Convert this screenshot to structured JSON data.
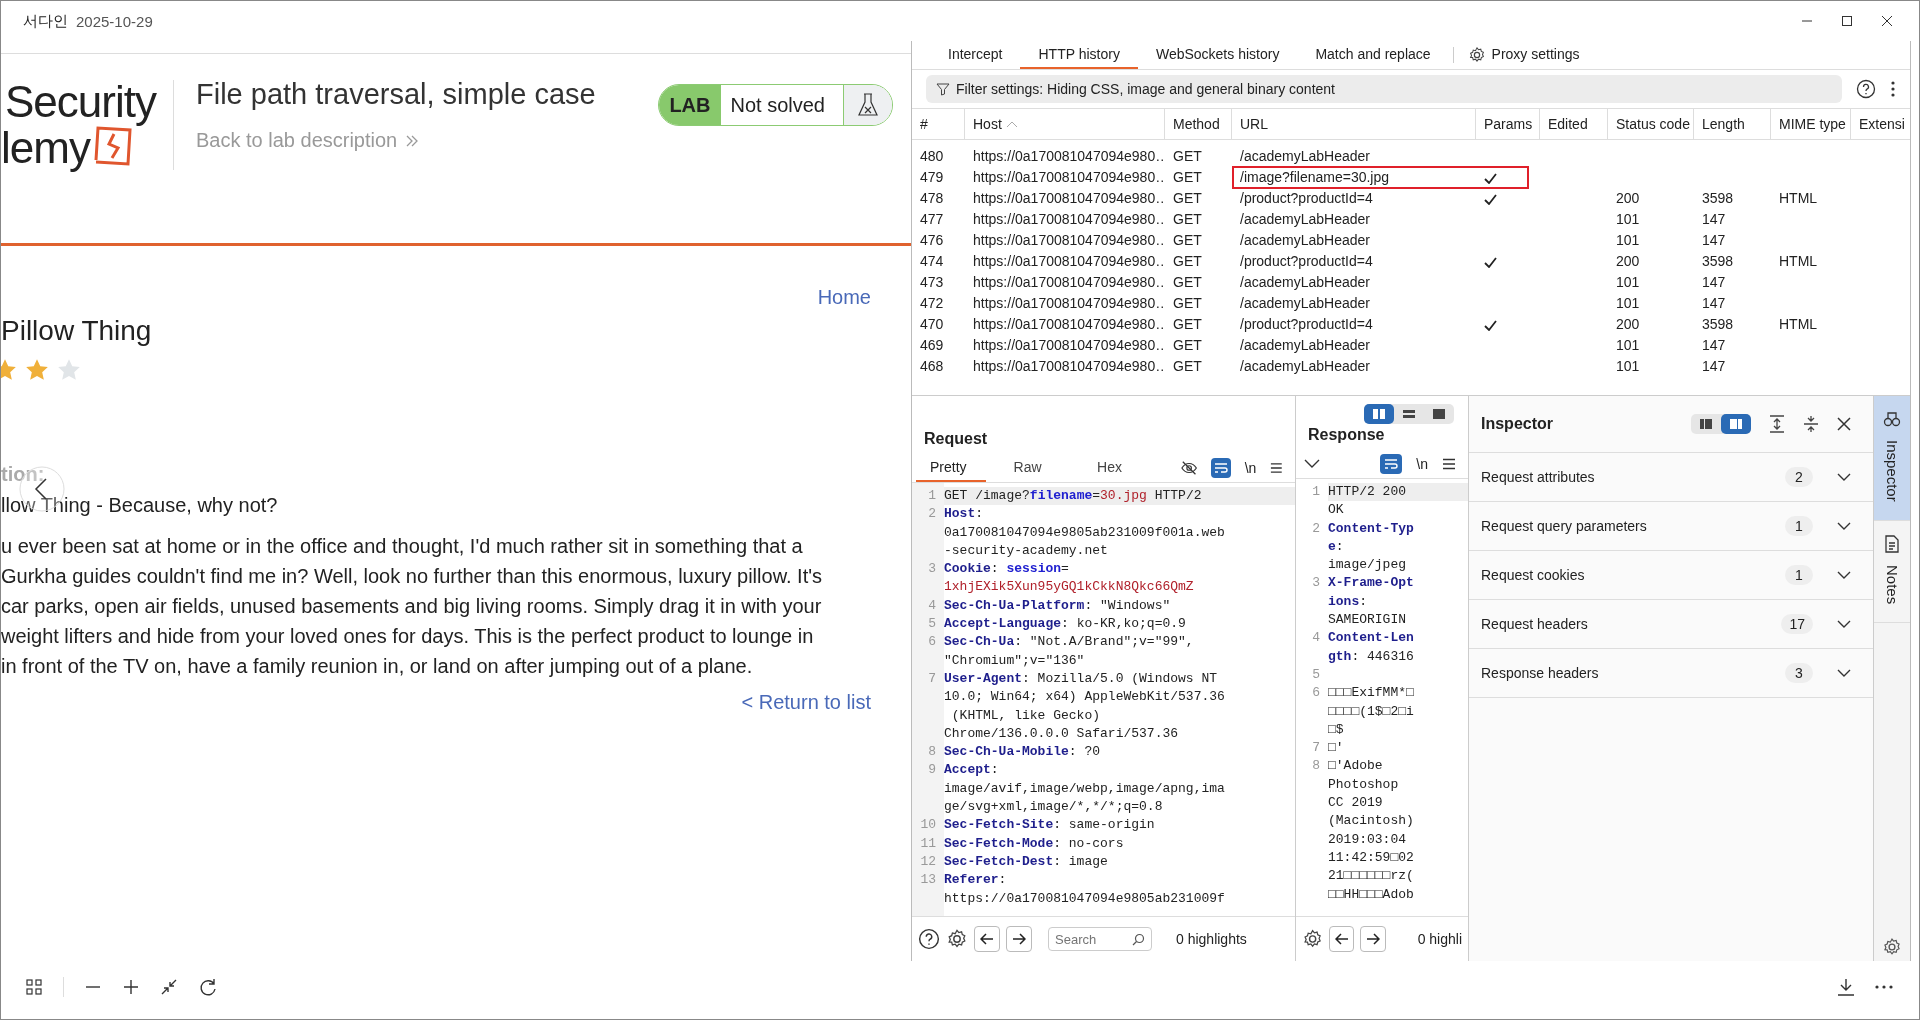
{
  "window": {
    "title": "서다인",
    "date": "2025-10-29"
  },
  "lab_page": {
    "logo_lines": [
      "Security",
      "lemy"
    ],
    "title": "File path traversal, simple case",
    "back_link": "Back to lab description",
    "status_label": "LAB",
    "status": "Not solved",
    "home_link": "Home",
    "product_name": "Pillow Thing",
    "stars": 2,
    "section_label": "tion:",
    "tagline": "llow Thing - Because, why not?",
    "description_lines": [
      "u ever been sat at home or in the office and thought, I'd much rather sit in something that a",
      "Gurkha guides couldn't find me in? Well, look no further than this enormous, luxury pillow. It's",
      "car parks, open air fields, unused basements and big living rooms. Simply drag it in with your",
      "weight lifters and hide from your loved ones for days. This is the perfect product to lounge in",
      "in front of the TV on, have a family reunion in, or land on after jumping out of a plane."
    ],
    "return_link": "< Return to list"
  },
  "burp": {
    "tabs": [
      {
        "label": "Intercept",
        "selected": false
      },
      {
        "label": "HTTP history",
        "selected": true
      },
      {
        "label": "WebSockets history",
        "selected": false
      },
      {
        "label": "Match and replace",
        "selected": false
      }
    ],
    "settings_tab": "Proxy settings",
    "filter": "Filter settings: Hiding CSS, image and general binary content",
    "table": {
      "columns": [
        "#",
        "Host",
        "Method",
        "URL",
        "Params",
        "Edited",
        "Status code",
        "Length",
        "MIME type",
        "Extensi"
      ],
      "rows": [
        {
          "num": "480",
          "host": "https://0a170081047094e980…",
          "method": "GET",
          "url": "/academyLabHeader",
          "params": false,
          "highlighted": false
        },
        {
          "num": "479",
          "host": "https://0a170081047094e980…",
          "method": "GET",
          "url": "/image?filename=30.jpg",
          "params": true,
          "highlighted": true
        },
        {
          "num": "478",
          "host": "https://0a170081047094e980…",
          "method": "GET",
          "url": "/product?productId=4",
          "params": true,
          "highlighted": false,
          "status": "200",
          "length": "3598",
          "mime": "HTML"
        },
        {
          "num": "477",
          "host": "https://0a170081047094e980…",
          "method": "GET",
          "url": "/academyLabHeader",
          "params": false,
          "highlighted": false,
          "status": "101",
          "length": "147"
        },
        {
          "num": "476",
          "host": "https://0a170081047094e980…",
          "method": "GET",
          "url": "/academyLabHeader",
          "params": false,
          "highlighted": false,
          "status": "101",
          "length": "147"
        },
        {
          "num": "474",
          "host": "https://0a170081047094e980…",
          "method": "GET",
          "url": "/product?productId=4",
          "params": true,
          "highlighted": false,
          "status": "200",
          "length": "3598",
          "mime": "HTML"
        },
        {
          "num": "473",
          "host": "https://0a170081047094e980…",
          "method": "GET",
          "url": "/academyLabHeader",
          "params": false,
          "highlighted": false,
          "status": "101",
          "length": "147"
        },
        {
          "num": "472",
          "host": "https://0a170081047094e980…",
          "method": "GET",
          "url": "/academyLabHeader",
          "params": false,
          "highlighted": false,
          "status": "101",
          "length": "147"
        },
        {
          "num": "470",
          "host": "https://0a170081047094e980…",
          "method": "GET",
          "url": "/product?productId=4",
          "params": true,
          "highlighted": false,
          "status": "200",
          "length": "3598",
          "mime": "HTML"
        },
        {
          "num": "469",
          "host": "https://0a170081047094e980…",
          "method": "GET",
          "url": "/academyLabHeader",
          "params": false,
          "highlighted": false,
          "status": "101",
          "length": "147"
        },
        {
          "num": "468",
          "host": "https://0a170081047094e980…",
          "method": "GET",
          "url": "/academyLabHeader",
          "params": false,
          "highlighted": false,
          "status": "101",
          "length": "147"
        }
      ]
    },
    "request": {
      "title": "Request",
      "tabs": [
        {
          "label": "Pretty",
          "selected": true
        },
        {
          "label": "Raw",
          "selected": false
        },
        {
          "label": "Hex",
          "selected": false
        }
      ],
      "wrap_on": true,
      "newline_toggle": "\\n",
      "lines": [
        {
          "num": "1",
          "rows": [
            [
              {
                "kind": "plain",
                "text": "GET /image?"
              },
              {
                "kind": "param",
                "text": "filename"
              },
              {
                "kind": "plain",
                "text": "="
              },
              {
                "kind": "value",
                "text": "30.jpg"
              },
              {
                "kind": "plain",
                "text": " HTTP/2"
              }
            ]
          ]
        },
        {
          "num": "2",
          "rows": [
            [
              {
                "kind": "key",
                "text": "Host"
              },
              {
                "kind": "plain",
                "text": ":"
              }
            ],
            [
              {
                "kind": "plain",
                "text": "0a170081047094e9805ab231009f001a.web"
              }
            ],
            [
              {
                "kind": "plain",
                "text": "-security-academy.net"
              }
            ]
          ]
        },
        {
          "num": "3",
          "rows": [
            [
              {
                "kind": "key",
                "text": "Cookie"
              },
              {
                "kind": "plain",
                "text": ": "
              },
              {
                "kind": "param",
                "text": "session"
              },
              {
                "kind": "plain",
                "text": "="
              }
            ],
            [
              {
                "kind": "value",
                "text": "1xhjEXik5Xun95yGQ1kCkkN8Qkc66QmZ"
              }
            ]
          ]
        },
        {
          "num": "4",
          "rows": [
            [
              {
                "kind": "key",
                "text": "Sec-Ch-Ua-Platform"
              },
              {
                "kind": "plain",
                "text": ": \"Windows\""
              }
            ]
          ]
        },
        {
          "num": "5",
          "rows": [
            [
              {
                "kind": "key",
                "text": "Accept-Language"
              },
              {
                "kind": "plain",
                "text": ": ko-KR,ko;q=0.9"
              }
            ]
          ]
        },
        {
          "num": "6",
          "rows": [
            [
              {
                "kind": "key",
                "text": "Sec-Ch-Ua"
              },
              {
                "kind": "plain",
                "text": ": \"Not.A/Brand\";v=\"99\","
              }
            ],
            [
              {
                "kind": "plain",
                "text": "\"Chromium\";v=\"136\""
              }
            ]
          ]
        },
        {
          "num": "7",
          "rows": [
            [
              {
                "kind": "key",
                "text": "User-Agent"
              },
              {
                "kind": "plain",
                "text": ": Mozilla/5.0 (Windows NT"
              }
            ],
            [
              {
                "kind": "plain",
                "text": "10.0; Win64; x64) AppleWebKit/537.36"
              }
            ],
            [
              {
                "kind": "plain",
                "text": " (KHTML, like Gecko)"
              }
            ],
            [
              {
                "kind": "plain",
                "text": "Chrome/136.0.0.0 Safari/537.36"
              }
            ]
          ]
        },
        {
          "num": "8",
          "rows": [
            [
              {
                "kind": "key",
                "text": "Sec-Ch-Ua-Mobile"
              },
              {
                "kind": "plain",
                "text": ": ?0"
              }
            ]
          ]
        },
        {
          "num": "9",
          "rows": [
            [
              {
                "kind": "key",
                "text": "Accept"
              },
              {
                "kind": "plain",
                "text": ":"
              }
            ],
            [
              {
                "kind": "plain",
                "text": "image/avif,image/webp,image/apng,ima"
              }
            ],
            [
              {
                "kind": "plain",
                "text": "ge/svg+xml,image/*,*/*;q=0.8"
              }
            ]
          ]
        },
        {
          "num": "10",
          "rows": [
            [
              {
                "kind": "key",
                "text": "Sec-Fetch-Site"
              },
              {
                "kind": "plain",
                "text": ": same-origin"
              }
            ]
          ]
        },
        {
          "num": "11",
          "rows": [
            [
              {
                "kind": "key",
                "text": "Sec-Fetch-Mode"
              },
              {
                "kind": "plain",
                "text": ": no-cors"
              }
            ]
          ]
        },
        {
          "num": "12",
          "rows": [
            [
              {
                "kind": "key",
                "text": "Sec-Fetch-Dest"
              },
              {
                "kind": "plain",
                "text": ": image"
              }
            ]
          ]
        },
        {
          "num": "13",
          "rows": [
            [
              {
                "kind": "key",
                "text": "Referer"
              },
              {
                "kind": "plain",
                "text": ":"
              }
            ],
            [
              {
                "kind": "plain",
                "text": "https://0a170081047094e9805ab231009f"
              }
            ]
          ]
        }
      ],
      "search_placeholder": "Search",
      "highlights": "0 highlights"
    },
    "response": {
      "title": "Response",
      "layout_buttons": [
        {
          "selected": true
        },
        {
          "selected": false
        },
        {
          "selected": false
        }
      ],
      "wrap_on": true,
      "newline_toggle": "\\n",
      "lines": [
        {
          "num": "1",
          "rows": [
            [
              {
                "kind": "plain",
                "text": "HTTP/2 200"
              }
            ],
            [
              {
                "kind": "plain",
                "text": "OK"
              }
            ]
          ]
        },
        {
          "num": "2",
          "rows": [
            [
              {
                "kind": "key",
                "text": "Content-Typ"
              }
            ],
            [
              {
                "kind": "key",
                "text": "e"
              },
              {
                "kind": "plain",
                "text": ":"
              }
            ],
            [
              {
                "kind": "plain",
                "text": "image/jpeg"
              }
            ]
          ]
        },
        {
          "num": "3",
          "rows": [
            [
              {
                "kind": "key",
                "text": "X-Frame-Opt"
              }
            ],
            [
              {
                "kind": "key",
                "text": "ions"
              },
              {
                "kind": "plain",
                "text": ":"
              }
            ],
            [
              {
                "kind": "plain",
                "text": "SAMEORIGIN"
              }
            ]
          ]
        },
        {
          "num": "4",
          "rows": [
            [
              {
                "kind": "key",
                "text": "Content-Len"
              }
            ],
            [
              {
                "kind": "key",
                "text": "gth"
              },
              {
                "kind": "plain",
                "text": ": 446316"
              }
            ]
          ]
        },
        {
          "num": "5"
        },
        {
          "num": "6",
          "rows": [
            [
              {
                "kind": "plain",
                "text": "□□□ExifMM*□"
              }
            ],
            [
              {
                "kind": "plain",
                "text": "□□□□(1$□2□i"
              }
            ],
            [
              {
                "kind": "plain",
                "text": "□$"
              }
            ]
          ]
        },
        {
          "num": "7",
          "rows": [
            [
              {
                "kind": "plain",
                "text": "□'"
              }
            ]
          ]
        },
        {
          "num": "8",
          "rows": [
            [
              {
                "kind": "plain",
                "text": "□'Adobe"
              }
            ],
            [
              {
                "kind": "plain",
                "text": "Photoshop"
              }
            ],
            [
              {
                "kind": "plain",
                "text": "CC 2019"
              }
            ],
            [
              {
                "kind": "plain",
                "text": "(Macintosh)"
              }
            ],
            [
              {
                "kind": "plain",
                "text": "2019:03:04"
              }
            ],
            [
              {
                "kind": "plain",
                "text": "11:42:59□02"
              }
            ],
            [
              {
                "kind": "plain",
                "text": "21□□□□□□rz("
              }
            ],
            [
              {
                "kind": "plain",
                "text": "□□HH□□□Adob"
              }
            ]
          ]
        }
      ],
      "highlights": "0 highli"
    },
    "inspector": {
      "title": "Inspector",
      "layout_buttons": [
        {
          "selected": false
        },
        {
          "selected": true
        }
      ],
      "sections": [
        {
          "label": "Request attributes",
          "count": "2"
        },
        {
          "label": "Request query parameters",
          "count": "1"
        },
        {
          "label": "Request cookies",
          "count": "1"
        },
        {
          "label": "Request headers",
          "count": "17"
        },
        {
          "label": "Response headers",
          "count": "3"
        }
      ]
    },
    "side_tabs": [
      {
        "label": "Inspector",
        "selected": true,
        "kind": "inspector"
      },
      {
        "label": "Notes",
        "selected": false,
        "kind": "notes"
      }
    ]
  }
}
